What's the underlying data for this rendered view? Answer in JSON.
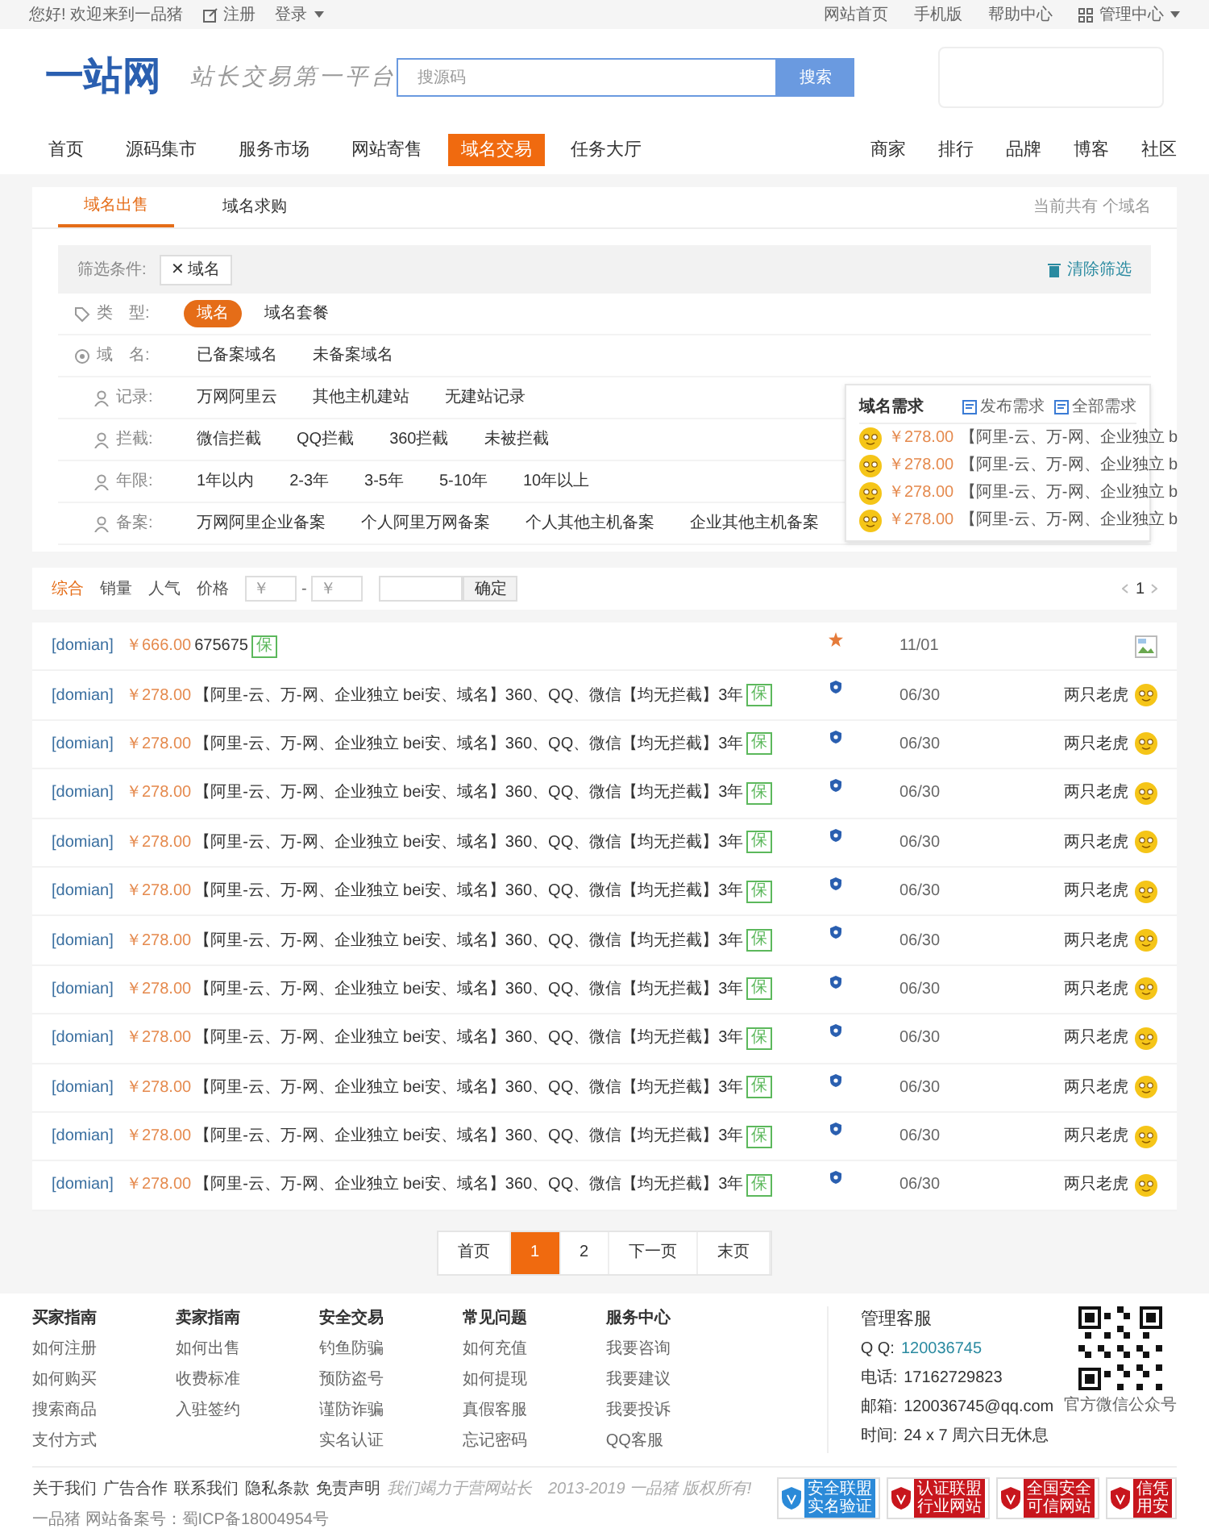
{
  "top_bar": {
    "greeting": "您好! 欢迎来到一品猪",
    "register": "注册",
    "login": "登录",
    "links": [
      "网站首页",
      "手机版",
      "帮助中心"
    ],
    "admin": "管理中心"
  },
  "header": {
    "logo": "一站网",
    "slogan": "站长交易第一平台",
    "search": {
      "placeholder": "搜源码",
      "button": "搜索"
    }
  },
  "nav": {
    "left": [
      {
        "label": "首页",
        "selected": false
      },
      {
        "label": "源码集市",
        "selected": false
      },
      {
        "label": "服务市场",
        "selected": false
      },
      {
        "label": "网站寄售",
        "selected": false
      },
      {
        "label": "域名交易",
        "selected": true
      },
      {
        "label": "任务大厅",
        "selected": false
      }
    ],
    "right": [
      "商家",
      "排行",
      "品牌",
      "博客",
      "社区"
    ]
  },
  "tabs": [
    {
      "label": "域名出售",
      "selected": true
    },
    {
      "label": "域名求购",
      "selected": false
    }
  ],
  "count_text": "当前共有  个域名",
  "filter": {
    "label": "筛选条件:",
    "chip": "✕ 域名",
    "clear": "清除筛选"
  },
  "filter_rows": [
    {
      "label": "类　型:",
      "kind": "tag",
      "options": [
        {
          "label": "域名",
          "selected": true
        },
        {
          "label": "域名套餐",
          "selected": false
        }
      ]
    },
    {
      "label": "域　名:",
      "kind": "circle",
      "options": [
        {
          "label": "已备案域名",
          "selected": false
        },
        {
          "label": "未备案域名",
          "selected": false
        }
      ]
    },
    {
      "label": "记录:",
      "kind": "user",
      "options": [
        {
          "label": "万网阿里云",
          "selected": false
        },
        {
          "label": "其他主机建站",
          "selected": false
        },
        {
          "label": "无建站记录",
          "selected": false
        }
      ]
    },
    {
      "label": "拦截:",
      "kind": "user",
      "options": [
        {
          "label": "微信拦截",
          "selected": false
        },
        {
          "label": "QQ拦截",
          "selected": false
        },
        {
          "label": "360拦截",
          "selected": false
        },
        {
          "label": "未被拦截",
          "selected": false
        }
      ]
    },
    {
      "label": "年限:",
      "kind": "user",
      "options": [
        {
          "label": "1年以内",
          "selected": false
        },
        {
          "label": "2-3年",
          "selected": false
        },
        {
          "label": "3-5年",
          "selected": false
        },
        {
          "label": "5-10年",
          "selected": false
        },
        {
          "label": "10年以上",
          "selected": false
        }
      ]
    },
    {
      "label": "备案:",
      "kind": "user",
      "options": [
        {
          "label": "万网阿里企业备案",
          "selected": false
        },
        {
          "label": "个人阿里万网备案",
          "selected": false
        },
        {
          "label": "个人其他主机备案",
          "selected": false
        },
        {
          "label": "企业其他主机备案",
          "selected": false
        }
      ]
    }
  ],
  "demand": {
    "title": "域名需求",
    "actions": [
      "发布需求",
      "全部需求"
    ],
    "items": [
      {
        "price": "￥278.00",
        "text": "【阿里-云、万-网、企业独立 b"
      },
      {
        "price": "￥278.00",
        "text": "【阿里-云、万-网、企业独立 b"
      },
      {
        "price": "￥278.00",
        "text": "【阿里-云、万-网、企业独立 b"
      },
      {
        "price": "￥278.00",
        "text": "【阿里-云、万-网、企业独立 b"
      }
    ]
  },
  "sort_bar": {
    "options": [
      {
        "label": "综合",
        "selected": true
      },
      {
        "label": "销量",
        "selected": false
      },
      {
        "label": "人气",
        "selected": false
      },
      {
        "label": "价格",
        "selected": false
      }
    ],
    "min_placeholder": "￥",
    "dash": "-",
    "max_placeholder": "￥",
    "confirm": "确定",
    "page": "1"
  },
  "listings": [
    {
      "tag": "[domian]",
      "price": "￥666.00",
      "title": "675675",
      "guarantee": "保",
      "kind": "featured",
      "date": "11/01"
    },
    {
      "tag": "[domian]",
      "price": "￥278.00",
      "title": "【阿里-云、万-网、企业独立 bei安、域名】360、QQ、微信【均无拦截】3年",
      "guarantee": "保",
      "kind": "regular",
      "date": "06/30",
      "seller": "两只老虎"
    },
    {
      "tag": "[domian]",
      "price": "￥278.00",
      "title": "【阿里-云、万-网、企业独立 bei安、域名】360、QQ、微信【均无拦截】3年",
      "guarantee": "保",
      "kind": "regular",
      "date": "06/30",
      "seller": "两只老虎"
    },
    {
      "tag": "[domian]",
      "price": "￥278.00",
      "title": "【阿里-云、万-网、企业独立 bei安、域名】360、QQ、微信【均无拦截】3年",
      "guarantee": "保",
      "kind": "regular",
      "date": "06/30",
      "seller": "两只老虎"
    },
    {
      "tag": "[domian]",
      "price": "￥278.00",
      "title": "【阿里-云、万-网、企业独立 bei安、域名】360、QQ、微信【均无拦截】3年",
      "guarantee": "保",
      "kind": "regular",
      "date": "06/30",
      "seller": "两只老虎"
    },
    {
      "tag": "[domian]",
      "price": "￥278.00",
      "title": "【阿里-云、万-网、企业独立 bei安、域名】360、QQ、微信【均无拦截】3年",
      "guarantee": "保",
      "kind": "regular",
      "date": "06/30",
      "seller": "两只老虎"
    },
    {
      "tag": "[domian]",
      "price": "￥278.00",
      "title": "【阿里-云、万-网、企业独立 bei安、域名】360、QQ、微信【均无拦截】3年",
      "guarantee": "保",
      "kind": "regular",
      "date": "06/30",
      "seller": "两只老虎"
    },
    {
      "tag": "[domian]",
      "price": "￥278.00",
      "title": "【阿里-云、万-网、企业独立 bei安、域名】360、QQ、微信【均无拦截】3年",
      "guarantee": "保",
      "kind": "regular",
      "date": "06/30",
      "seller": "两只老虎"
    },
    {
      "tag": "[domian]",
      "price": "￥278.00",
      "title": "【阿里-云、万-网、企业独立 bei安、域名】360、QQ、微信【均无拦截】3年",
      "guarantee": "保",
      "kind": "regular",
      "date": "06/30",
      "seller": "两只老虎"
    },
    {
      "tag": "[domian]",
      "price": "￥278.00",
      "title": "【阿里-云、万-网、企业独立 bei安、域名】360、QQ、微信【均无拦截】3年",
      "guarantee": "保",
      "kind": "regular",
      "date": "06/30",
      "seller": "两只老虎"
    },
    {
      "tag": "[domian]",
      "price": "￥278.00",
      "title": "【阿里-云、万-网、企业独立 bei安、域名】360、QQ、微信【均无拦截】3年",
      "guarantee": "保",
      "kind": "regular",
      "date": "06/30",
      "seller": "两只老虎"
    },
    {
      "tag": "[domian]",
      "price": "￥278.00",
      "title": "【阿里-云、万-网、企业独立 bei安、域名】360、QQ、微信【均无拦截】3年",
      "guarantee": "保",
      "kind": "regular",
      "date": "06/30",
      "seller": "两只老虎"
    }
  ],
  "pagination": [
    {
      "label": "首页",
      "selected": false
    },
    {
      "label": "1",
      "selected": true
    },
    {
      "label": "2",
      "selected": false
    },
    {
      "label": "下一页",
      "selected": false
    },
    {
      "label": "末页",
      "selected": false
    }
  ],
  "footer": {
    "columns": [
      {
        "title": "买家指南",
        "links": [
          "如何注册",
          "如何购买",
          "搜索商品",
          "支付方式"
        ]
      },
      {
        "title": "卖家指南",
        "links": [
          "如何出售",
          "收费标准",
          "入驻签约"
        ]
      },
      {
        "title": "安全交易",
        "links": [
          "钓鱼防骗",
          "预防盗号",
          "谨防诈骗",
          "实名认证"
        ]
      },
      {
        "title": "常见问题",
        "links": [
          "如何充值",
          "如何提现",
          "真假客服",
          "忘记密码"
        ]
      },
      {
        "title": "服务中心",
        "links": [
          "我要咨询",
          "我要建议",
          "我要投诉",
          "QQ客服"
        ]
      }
    ],
    "contact": {
      "title": "管理客服",
      "rows": [
        {
          "label": "Q Q:",
          "value": "120036745"
        },
        {
          "label": "电话:",
          "value": "17162729823"
        },
        {
          "label": "邮箱:",
          "value": "120036745@qq.com"
        },
        {
          "label": "时间:",
          "value": "24 x 7 周六日无休息"
        }
      ]
    },
    "qr_caption": "官方微信公众号",
    "bottom_links": [
      "关于我们",
      "广告合作",
      "联系我们",
      "隐私条款",
      "免责声明"
    ],
    "slogan": "我们竭力于营网站长",
    "copyright": "2013-2019 一品猪 版权所有!",
    "icp": "一品猪  网站备案号：蜀ICP备18004954号",
    "badges": [
      {
        "lines": [
          "安全联盟",
          "实名验证"
        ],
        "color": "#2b8ad8"
      },
      {
        "lines": [
          "认证联盟",
          "行业网站"
        ],
        "color": "#c8161d"
      },
      {
        "lines": [
          "全国安全",
          "可信网站"
        ],
        "color": "#c8161d"
      },
      {
        "lines": [
          "信凭",
          "用安"
        ],
        "color": "#c8161d"
      }
    ]
  }
}
